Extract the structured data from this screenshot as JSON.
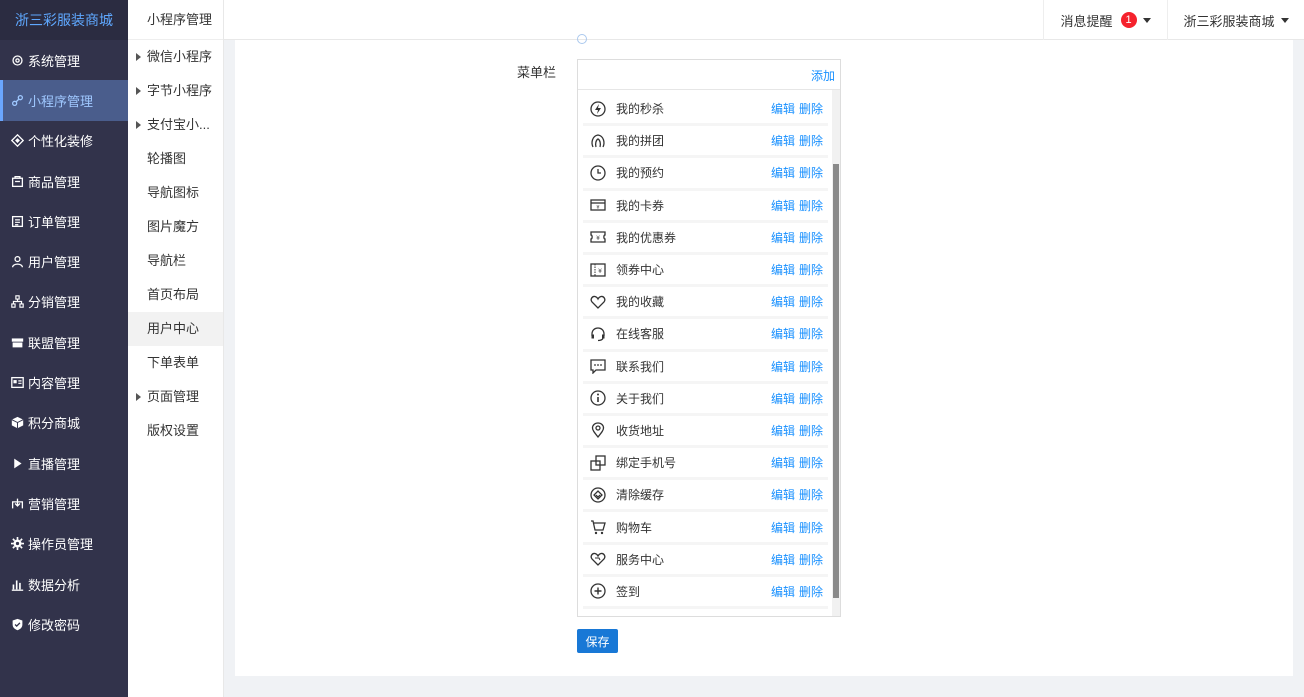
{
  "sidebar": {
    "brand": "浙三彩服装商城",
    "items": [
      {
        "label": "系统管理",
        "icon": "gear-icon"
      },
      {
        "label": "小程序管理",
        "icon": "link-icon"
      },
      {
        "label": "个性化装修",
        "icon": "diamond-icon"
      },
      {
        "label": "商品管理",
        "icon": "bag-icon"
      },
      {
        "label": "订单管理",
        "icon": "order-icon"
      },
      {
        "label": "用户管理",
        "icon": "user-icon"
      },
      {
        "label": "分销管理",
        "icon": "hierarchy-icon"
      },
      {
        "label": "联盟管理",
        "icon": "store-icon"
      },
      {
        "label": "内容管理",
        "icon": "content-icon"
      },
      {
        "label": "积分商城",
        "icon": "cube-icon"
      },
      {
        "label": "直播管理",
        "icon": "play-icon"
      },
      {
        "label": "营销管理",
        "icon": "marketing-icon"
      },
      {
        "label": "操作员管理",
        "icon": "cog-icon"
      },
      {
        "label": "数据分析",
        "icon": "bar-chart-icon"
      },
      {
        "label": "修改密码",
        "icon": "shield-icon"
      }
    ]
  },
  "subnav": {
    "title": "小程序管理",
    "items": [
      {
        "label": "微信小程序"
      },
      {
        "label": "字节小程序"
      },
      {
        "label": "支付宝小..."
      },
      {
        "label": "轮播图"
      },
      {
        "label": "导航图标"
      },
      {
        "label": "图片魔方"
      },
      {
        "label": "导航栏"
      },
      {
        "label": "首页布局"
      },
      {
        "label": "用户中心"
      },
      {
        "label": "下单表单"
      },
      {
        "label": "页面管理"
      },
      {
        "label": "版权设置"
      }
    ]
  },
  "topbar": {
    "messages_label": "消息提醒",
    "messages_count": "1",
    "user_label": "浙三彩服装商城"
  },
  "form": {
    "menu_label": "菜单栏",
    "add_label": "添加",
    "edit_label": "编辑",
    "delete_label": "删除",
    "save_label": "保存",
    "menu_items": [
      {
        "name": "我的秒杀",
        "icon": "lightning-icon"
      },
      {
        "name": "我的拼团",
        "icon": "group-icon"
      },
      {
        "name": "我的预约",
        "icon": "clock-icon"
      },
      {
        "name": "我的卡券",
        "icon": "card-voucher-icon"
      },
      {
        "name": "我的优惠券",
        "icon": "coupon-icon"
      },
      {
        "name": "领券中心",
        "icon": "coupon-center-icon"
      },
      {
        "name": "我的收藏",
        "icon": "heart-icon"
      },
      {
        "name": "在线客服",
        "icon": "headset-icon"
      },
      {
        "name": "联系我们",
        "icon": "chat-icon"
      },
      {
        "name": "关于我们",
        "icon": "info-icon"
      },
      {
        "name": "收货地址",
        "icon": "location-icon"
      },
      {
        "name": "绑定手机号",
        "icon": "phone-bind-icon"
      },
      {
        "name": "清除缓存",
        "icon": "clear-cache-icon"
      },
      {
        "name": "购物车",
        "icon": "cart-icon"
      },
      {
        "name": "服务中心",
        "icon": "service-heart-icon"
      },
      {
        "name": "签到",
        "icon": "plus-circle-icon"
      }
    ]
  }
}
